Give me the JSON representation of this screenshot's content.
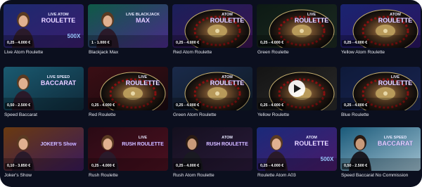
{
  "games": [
    {
      "title": "Live Atom Roulette",
      "range": "0,25 - 4.000 €",
      "logo_top": "LIVE ATOM",
      "logo_main": "ROULETTE",
      "badge": "500X",
      "c1": "#1b2a6e",
      "c2": "#3a1d6e",
      "kind": "dealer-f"
    },
    {
      "title": "Blackjack Max",
      "range": "1 - 1.000 €",
      "logo_top": "LIVE BLACKJACK",
      "logo_main": "MAX",
      "badge": "",
      "c1": "#0e5a46",
      "c2": "#4a2a8a",
      "kind": "dealer-f"
    },
    {
      "title": "Red Atom Roulette",
      "range": "0,25 - 4.000 €",
      "logo_top": "ATOM",
      "logo_main": "ROULETTE",
      "badge": "",
      "c1": "#1a1f5a",
      "c2": "#3b1350",
      "kind": "wheel"
    },
    {
      "title": "Green Roulette",
      "range": "0,25 - 4.000 €",
      "logo_top": "LIVE",
      "logo_main": "ROULETTE",
      "badge": "",
      "c1": "#0d1a14",
      "c2": "#1c2a22",
      "kind": "wheel"
    },
    {
      "title": "Yellow Atom Roulette",
      "range": "0,25 - 4.000 €",
      "logo_top": "ATOM",
      "logo_main": "ROULETTE",
      "badge": "",
      "c1": "#1a2470",
      "c2": "#2a1460",
      "kind": "wheel"
    },
    {
      "title": "Speed Baccarat",
      "range": "0,50 - 2.500 €",
      "logo_top": "LIVE SPEED",
      "logo_main": "BACCARAT",
      "badge": "",
      "c1": "#1a5a70",
      "c2": "#0f2a3a",
      "kind": "dealer-f"
    },
    {
      "title": "Red Roulette",
      "range": "0,25 - 4.000 €",
      "logo_top": "LIVE",
      "logo_main": "ROULETTE",
      "badge": "",
      "c1": "#3a0e14",
      "c2": "#1a0a10",
      "kind": "wheel"
    },
    {
      "title": "Green Atom Roulette",
      "range": "0,25 - 4.000 €",
      "logo_top": "ATOM",
      "logo_main": "ROULETTE",
      "badge": "",
      "c1": "#1a2a4a",
      "c2": "#0f1a24",
      "kind": "wheel"
    },
    {
      "title": "Yellow Roulette",
      "range": "0,25 - 4.000 €",
      "logo_top": "",
      "logo_main": "",
      "badge": "",
      "c1": "#141414",
      "c2": "#2a2a2a",
      "kind": "wheel-play"
    },
    {
      "title": "Blue Roulette",
      "range": "0,25 - 4.000 €",
      "logo_top": "LIVE",
      "logo_main": "ROULETTE",
      "badge": "",
      "c1": "#0e1a3a",
      "c2": "#1a2450",
      "kind": "wheel"
    },
    {
      "title": "Joker's Show",
      "range": "0,10 - 3.850 €",
      "logo_top": "",
      "logo_main": "JOKER'S Show",
      "badge": "",
      "c1": "#6a3a10",
      "c2": "#3a1a5a",
      "kind": "dealer-f"
    },
    {
      "title": "Rush Roulette",
      "range": "0,25 - 4.000 €",
      "logo_top": "LIVE",
      "logo_main": "RUSH ROULETTE",
      "badge": "",
      "c1": "#2a0a14",
      "c2": "#4a1020",
      "kind": "dealer-f"
    },
    {
      "title": "Rush Atom Roulette",
      "range": "0,25 - 4.000 €",
      "logo_top": "ATOM",
      "logo_main": "RUSH ROULETTE",
      "badge": "",
      "c1": "#14101e",
      "c2": "#2a1a3a",
      "kind": "dealer-m"
    },
    {
      "title": "Roulette Atom A03",
      "range": "0,25 - 4.000 €",
      "logo_top": "ATOM",
      "logo_main": "ROULETTE",
      "badge": "500X",
      "c1": "#1a2a7a",
      "c2": "#4a1a6a",
      "kind": "dealer-f"
    },
    {
      "title": "Speed Baccarat No Commission",
      "range": "0,50 - 2.500 €",
      "logo_top": "LIVE SPEED",
      "logo_main": "BACCARAT",
      "badge": "",
      "c1": "#1a5a7a",
      "c2": "#a0c0d0",
      "kind": "dealer-m"
    }
  ],
  "play_icon": "play-icon"
}
